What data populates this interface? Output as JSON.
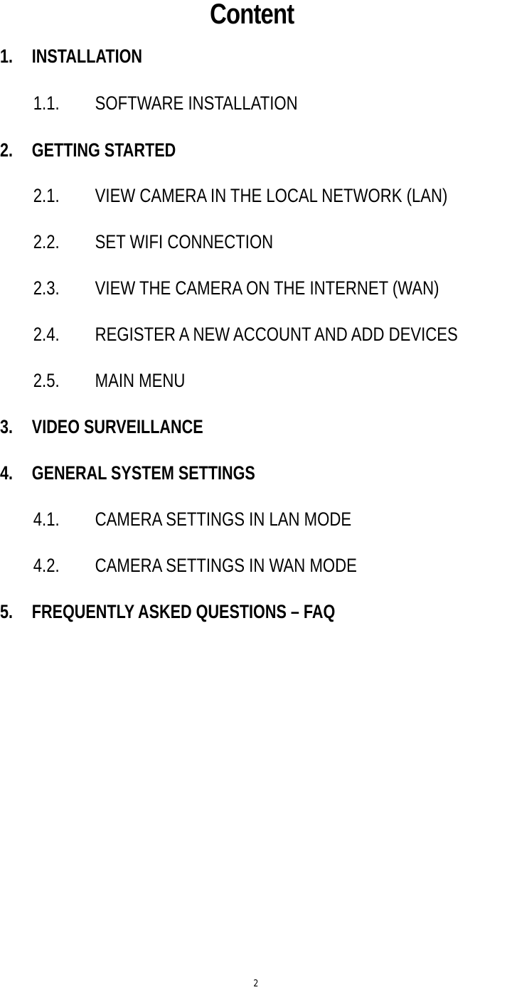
{
  "document": {
    "title": "Content",
    "page_number": "2",
    "toc": [
      {
        "level": 1,
        "number": "1.",
        "text": "INSTALLATION"
      },
      {
        "level": 2,
        "number": "1.1.",
        "text": "SOFTWARE INSTALLATION"
      },
      {
        "level": 1,
        "number": "2.",
        "text": "GETTING STARTED"
      },
      {
        "level": 2,
        "number": "2.1.",
        "text": "VIEW CAMERA IN THE LOCAL NETWORK (LAN)"
      },
      {
        "level": 2,
        "number": "2.2.",
        "text": "SET WIFI CONNECTION"
      },
      {
        "level": 2,
        "number": "2.3.",
        "text": "VIEW THE CAMERA ON THE INTERNET (WAN)"
      },
      {
        "level": 2,
        "number": "2.4.",
        "text": "REGISTER A NEW ACCOUNT AND ADD DEVICES"
      },
      {
        "level": 2,
        "number": "2.5.",
        "text": "MAIN MENU"
      },
      {
        "level": 1,
        "number": "3.",
        "text": "VIDEO SURVEILLANCE"
      },
      {
        "level": 1,
        "number": "4.",
        "text": "GENERAL SYSTEM SETTINGS"
      },
      {
        "level": 2,
        "number": "4.1.",
        "text": "CAMERA SETTINGS IN LAN MODE"
      },
      {
        "level": 2,
        "number": "4.2.",
        "text": "CAMERA SETTINGS IN WAN MODE"
      },
      {
        "level": 1,
        "number": "5.",
        "text": "FREQUENTLY ASKED QUESTIONS – FAQ"
      }
    ]
  }
}
